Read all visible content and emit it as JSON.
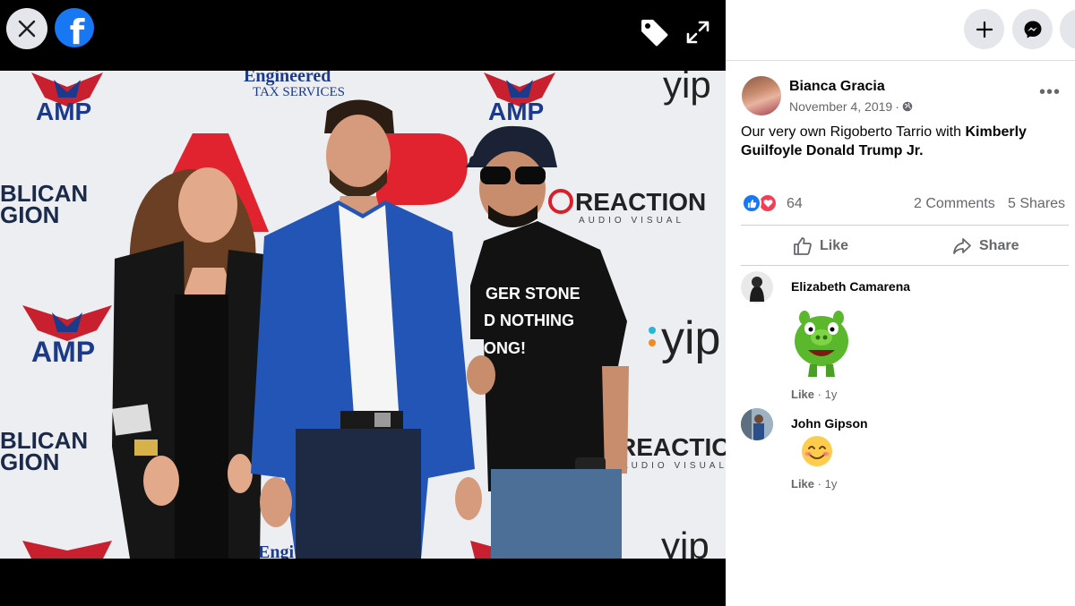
{
  "viewer": {
    "close_icon": "close-icon",
    "logo_letter": "f",
    "tag_icon": "tag-icon",
    "expand_icon": "expand-icon",
    "photo": {
      "backdrop": {
        "brand_1": "AMP",
        "brand_2": "Engineered",
        "brand_2_sub": "TAX SERVICES",
        "brand_3": "yip",
        "brand_4": "REACTION",
        "brand_4_sub": "AUDIO VISUAL",
        "brand_5_line1": "BLICAN",
        "brand_5_line2": "GION",
        "brand_6": "Engi"
      },
      "shirt_text": [
        "GER STONE",
        "D NOTHING",
        "ONG!"
      ]
    }
  },
  "panel": {
    "create_icon": "plus-icon",
    "messenger_icon": "messenger-icon",
    "account_icon": "account-icon"
  },
  "post": {
    "author": "Bianca Gracia",
    "date": "November 4, 2019",
    "separator": "·",
    "privacy_icon": "globe-icon",
    "more_label": "•••",
    "text_plain": "Our very own Rigoberto Tarrio with ",
    "text_bold": "Kimberly Guilfoyle Donald Trump Jr.",
    "reaction_count": "64",
    "comments_count": "2 Comments",
    "shares_count": "5 Shares",
    "like_label": "Like",
    "share_label": "Share"
  },
  "comments": [
    {
      "author": "Elizabeth Camarena",
      "attachment": "green pig sticker",
      "like_label": "Like",
      "separator": "·",
      "age": "1y"
    },
    {
      "author": "John Gipson",
      "attachment": "😊",
      "like_label": "Like",
      "separator": "·",
      "age": "1y"
    }
  ],
  "colors": {
    "facebook_blue": "#1877f2",
    "love_red": "#f33e58",
    "secondary_text": "#65676b",
    "button_gray": "#e4e6eb"
  }
}
